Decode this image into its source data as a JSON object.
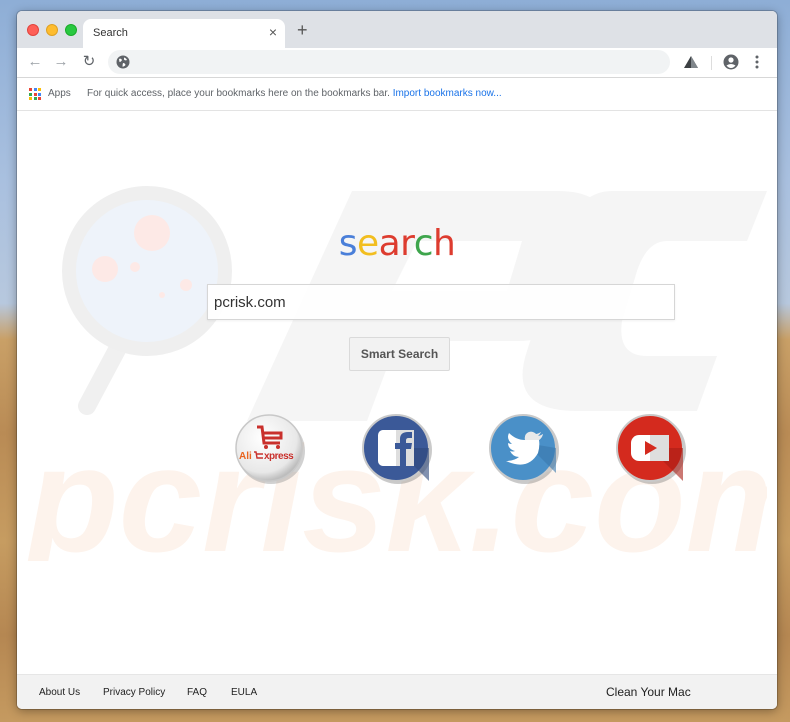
{
  "browser": {
    "tab": {
      "title": "Search",
      "close_glyph": "×"
    },
    "new_tab_glyph": "+",
    "nav": {
      "back_glyph": "←",
      "forward_glyph": "→",
      "reload_glyph": "↻"
    },
    "omnibox": {
      "value": "",
      "icon": "globe-icon"
    },
    "toolbar_icons": [
      "extension-icon",
      "profile-icon",
      "menu-icon"
    ]
  },
  "bookmarks_bar": {
    "apps_label": "Apps",
    "hint_text": "For quick access, place your bookmarks here on the bookmarks bar.",
    "import_link": "Import bookmarks now..."
  },
  "page": {
    "logo": {
      "letters": [
        {
          "char": "s",
          "color": "#4a7fd9"
        },
        {
          "char": "e",
          "color": "#f2be1f"
        },
        {
          "char": "a",
          "color": "#dd3c2f"
        },
        {
          "char": "r",
          "color": "#dd3c2f"
        },
        {
          "char": "c",
          "color": "#3ea54c"
        },
        {
          "char": "h",
          "color": "#dd3c2f"
        }
      ]
    },
    "search": {
      "value": "pcrisk.com",
      "button_label": "Smart Search"
    },
    "shortcuts": [
      {
        "name": "AliExpress",
        "label_left": "Ali",
        "label_right": "xpress",
        "color": "#c9302c"
      },
      {
        "name": "Facebook",
        "color": "#3b5998"
      },
      {
        "name": "Twitter",
        "color": "#4a90c8"
      },
      {
        "name": "YouTube",
        "color": "#d42a1e"
      }
    ],
    "watermark": "pcrisk.com"
  },
  "footer": {
    "links": [
      "About Us",
      "Privacy Policy",
      "FAQ",
      "EULA"
    ],
    "right_link": "Clean Your Mac"
  }
}
